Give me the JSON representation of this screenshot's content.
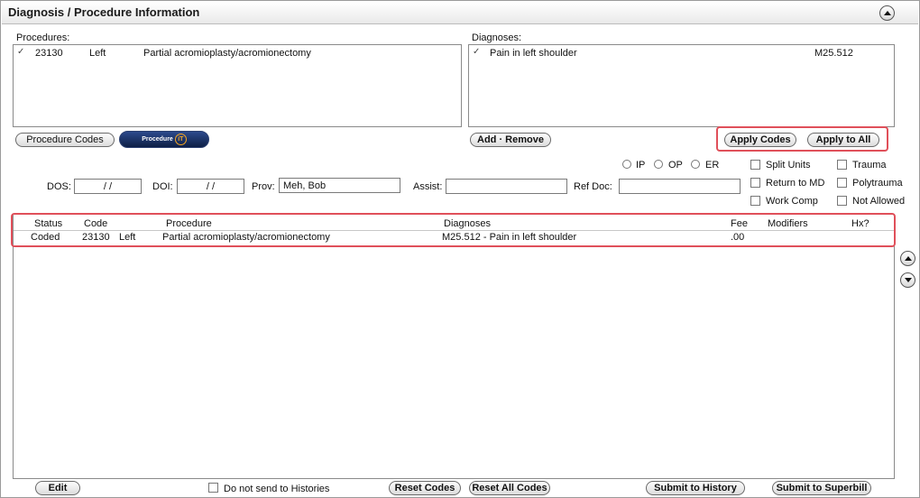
{
  "header": {
    "title": "Diagnosis / Procedure Information"
  },
  "procedures": {
    "label": "Procedures:",
    "items": [
      {
        "check": "✓",
        "code": "23130",
        "side": "Left",
        "description": "Partial acromioplasty/acromionectomy"
      }
    ],
    "codes_button": "Procedure Codes",
    "procedure_it_button": "Procedure",
    "procedure_it_badge": "iT"
  },
  "diagnoses": {
    "label": "Diagnoses:",
    "items": [
      {
        "check": "✓",
        "description": "Pain in left shoulder",
        "code": "M25.512"
      }
    ],
    "add_remove_button": "Add · Remove",
    "apply_codes_button": "Apply Codes",
    "apply_all_button": "Apply to All"
  },
  "form": {
    "dos_label": "DOS:",
    "dos_value": "/ /",
    "doi_label": "DOI:",
    "doi_value": "/ /",
    "prov_label": "Prov:",
    "prov_value": "Meh, Bob",
    "assist_label": "Assist:",
    "assist_value": "",
    "refdoc_label": "Ref Doc:",
    "refdoc_value": "",
    "radios": [
      "IP",
      "OP",
      "ER"
    ],
    "checks_col1": [
      "Split Units",
      "Return to MD",
      "Work Comp"
    ],
    "checks_col2": [
      "Trauma",
      "Polytrauma",
      "Not Allowed"
    ]
  },
  "table": {
    "headers": {
      "status": "Status",
      "code": "Code",
      "procedure": "Procedure",
      "diagnoses": "Diagnoses",
      "fee": "Fee",
      "modifiers": "Modifiers",
      "hx": "Hx?"
    },
    "rows": [
      {
        "status": "Coded",
        "code": "23130",
        "side": "Left",
        "procedure": "Partial acromioplasty/acromionectomy",
        "diagnoses": "M25.512 - Pain in left shoulder",
        "fee": ".00",
        "modifiers": "",
        "hx": ""
      }
    ]
  },
  "footer": {
    "edit_button": "Edit",
    "no_history_label": "Do not send to Histories",
    "reset_codes_button": "Reset Codes",
    "reset_all_button": "Reset All Codes",
    "submit_history_button": "Submit to History",
    "submit_superbill_button": "Submit to Superbill"
  }
}
